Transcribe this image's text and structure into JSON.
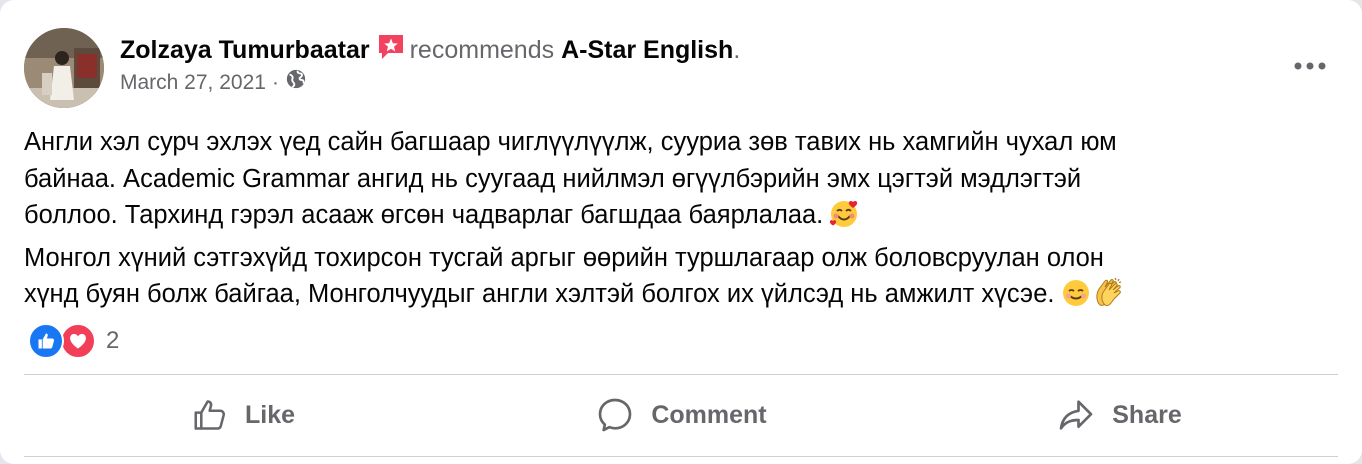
{
  "post": {
    "author": "Zolzaya Tumurbaatar",
    "verb": "recommends",
    "page_name": "A-Star English",
    "page_suffix": ".",
    "date": "March 27, 2021",
    "separator": "·",
    "privacy_icon": "globe-icon",
    "recommend_icon": "star-flag-icon",
    "accent_color": "#f3425f",
    "body_lines": [
      "Англи хэл сурч эхлэх үед сайн багшаар чиглүүлүүлж, сууриа зөв тавих нь хамгийн чухал юм",
      "байнаа. Academic Grammar ангид нь суугаад нийлмэл өгүүлбэрийн эмх цэгтэй мэдлэгтэй",
      "боллоо. Тархинд гэрэл асааж өгсөн чадварлаг багшдаа баярлалаа.",
      "Монгол хүний сэтгэхүйд тохирсон тусгай аргыг өөрийн туршлагаар олж боловсруулан олон",
      "хүнд буян болж байгаа, Монголчуудыг англи хэлтэй болгох их үйлсэд нь амжилт хүсэе."
    ],
    "emojis": [
      "smiling-face-with-hearts",
      "smiling-face",
      "clapping-hands"
    ]
  },
  "reactions": {
    "types": [
      "like",
      "love"
    ],
    "count": "2",
    "like_color": "#1877f2",
    "love_color": "#f33e58"
  },
  "actions": {
    "like_label": "Like",
    "comment_label": "Comment",
    "share_label": "Share"
  }
}
